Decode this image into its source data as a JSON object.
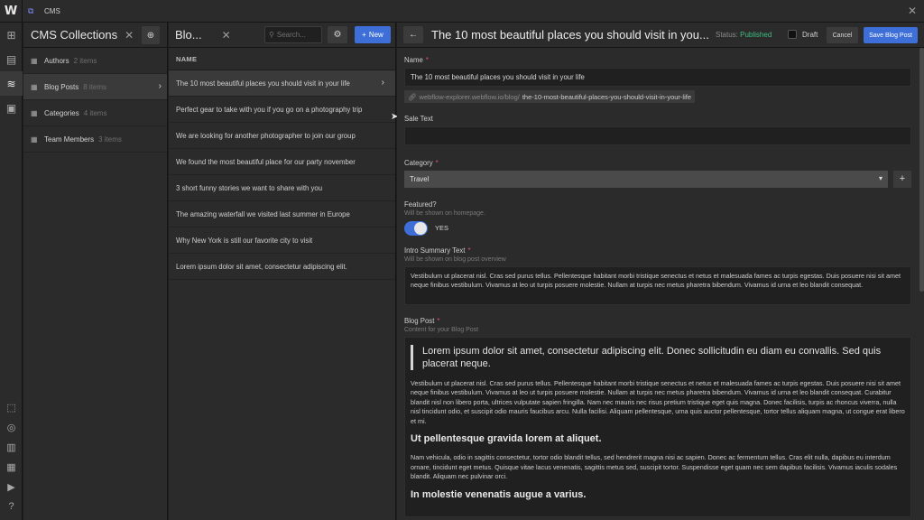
{
  "topbar": {
    "logo": "W",
    "section": "CMS"
  },
  "collections": {
    "title": "CMS Collections",
    "items": [
      {
        "name": "Authors",
        "count": "2 items"
      },
      {
        "name": "Blog Posts",
        "count": "8 items"
      },
      {
        "name": "Categories",
        "count": "4 items"
      },
      {
        "name": "Team Members",
        "count": "3 items"
      }
    ]
  },
  "posts": {
    "title": "Blo...",
    "search_placeholder": "Search...",
    "new_label": "New",
    "column_header": "NAME",
    "items": [
      "The 10 most beautiful places you should visit in your life",
      "Perfect gear to take with you if you go on a photography trip",
      "We are looking for another photographer to join our group",
      "We found the most beautiful place for our party november",
      "3 short funny stories we want to share with you",
      "The amazing waterfall we visited last summer in Europe",
      "Why New York is still our favorite city to visit",
      "Lorem ipsum dolor sit amet, consectetur adipiscing elit."
    ]
  },
  "editor": {
    "title": "The 10 most beautiful places you should visit in you...",
    "status_label": "Status:",
    "status_value": "Published",
    "draft_label": "Draft",
    "cancel_label": "Cancel",
    "save_label": "Save Blog Post",
    "name_label": "Name",
    "name_value": "The 10 most beautiful places you should visit in your life",
    "slug_prefix": "webflow-explorer.webflow.io/blog/",
    "slug_value": "the-10-most-beautiful-places-you-should-visit-in-your-life",
    "sale_label": "Sale Text",
    "category_label": "Category",
    "category_value": "Travel",
    "featured_label": "Featured?",
    "featured_hint": "Will be shown on homepage.",
    "featured_value": "YES",
    "intro_label": "Intro Summary Text",
    "intro_hint": "Will be shown on blog post overview",
    "intro_value": "Vestibulum ut placerat nisl. Cras sed purus tellus. Pellentesque habitant morbi tristique senectus et netus et malesuada fames ac turpis egestas. Duis posuere nisi sit amet neque finibus vestibulum. Vivamus at leo ut turpis posuere molestie. Nullam at turpis nec metus pharetra bibendum. Vivamus id urna et leo blandit consequat.",
    "post_label": "Blog Post",
    "post_hint": "Content for your Blog Post",
    "post_quote": "Lorem ipsum dolor sit amet, consectetur adipiscing elit. Donec sollicitudin eu diam eu convallis. Sed quis placerat neque.",
    "post_p1": "Vestibulum ut placerat nisl. Cras sed purus tellus. Pellentesque habitant morbi tristique senectus et netus et malesuada fames ac turpis egestas. Duis posuere nisi sit amet neque finibus vestibulum. Vivamus at leo ut turpis posuere molestie. Nullam at turpis nec metus pharetra bibendum. Vivamus id urna et leo blandit consequat. Curabitur blandit nisl non libero porta, ultrices vulputate sapien fringilla. Nam nec mauris nec risus pretium tristique eget quis magna. Donec facilisis, turpis ac rhoncus viverra, nulla nisl tincidunt odio, et suscipit odio mauris faucibus arcu. Nulla facilisi. Aliquam pellentesque, urna quis auctor pellentesque, tortor tellus aliquam magna, ut congue erat libero et mi.",
    "post_h1": "Ut pellentesque gravida lorem at aliquet.",
    "post_p2": "Nam vehicula, odio in sagittis consectetur, tortor odio blandit tellus, sed hendrerit magna nisi ac sapien. Donec ac fermentum tellus. Cras elit nulla, dapibus eu interdum ornare, tincidunt eget metus. Quisque vitae lacus venenatis, sagittis metus sed, suscipit tortor. Suspendisse eget quam nec sem dapibus facilisis. Vivamus iaculis sodales blandit. Aliquam nec pulvinar orci.",
    "post_h2": "In molestie venenatis augue a varius."
  },
  "colors": {
    "accent": "#3e6fd8",
    "published": "#3ebc82",
    "required": "#e0526a"
  }
}
